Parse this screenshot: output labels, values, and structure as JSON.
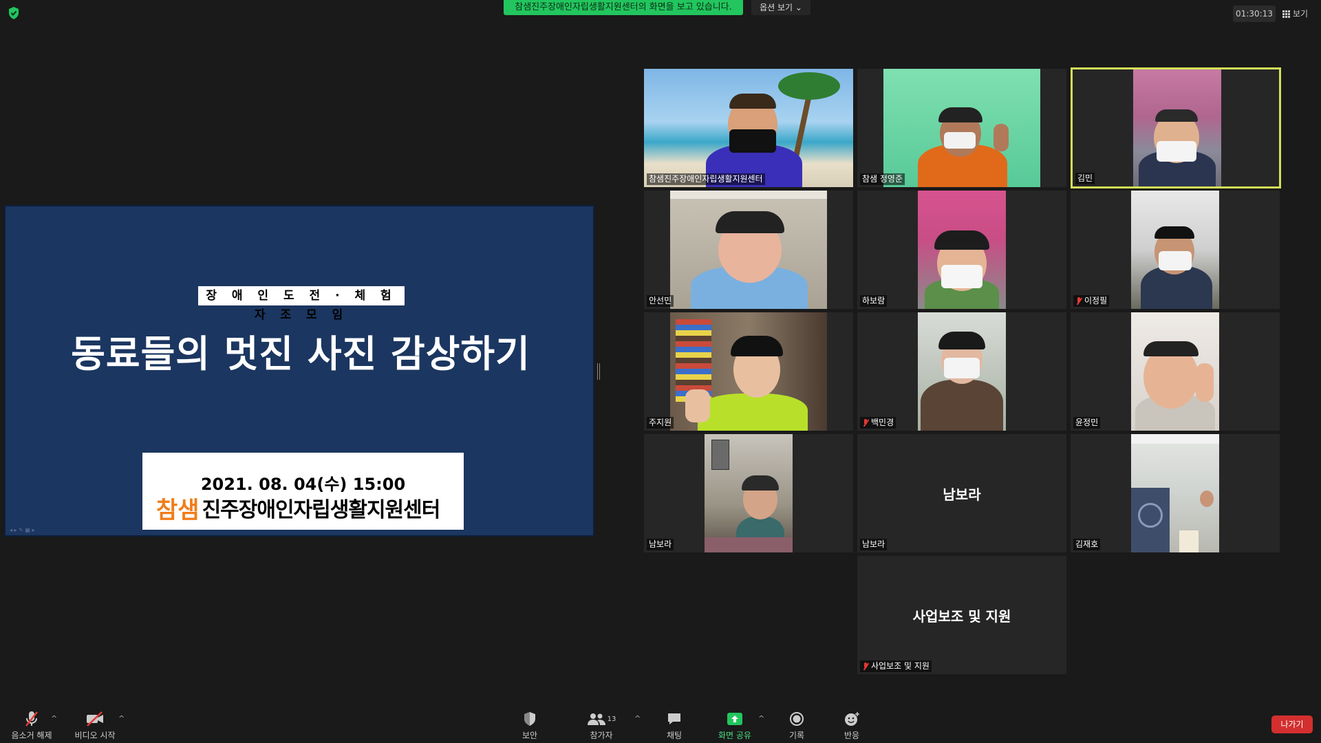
{
  "top": {
    "share_banner": "참샘진주장애인자립생활지원센터의 화면을 보고 있습니다.",
    "view_options": "옵션 보기",
    "timer": "01:30:13",
    "layout_label": "보기"
  },
  "slide": {
    "subtitle": "장 애 인 도 전 · 체 험 자 조 모 임",
    "title": "동료들의 멋진 사진 감상하기",
    "date": "2021. 08. 04(수) 15:00",
    "logo_text": "참샘",
    "org_name": "진주장애인자립생활지원센터"
  },
  "participants": [
    {
      "name": "참샘진주장애인자립생활지원센터",
      "muted": false
    },
    {
      "name": "참샘  정영준",
      "muted": false
    },
    {
      "name": "김민",
      "muted": false,
      "active_speaker": true
    },
    {
      "name": "안선민",
      "muted": false
    },
    {
      "name": "하보람",
      "muted": false
    },
    {
      "name": "이정필",
      "muted": true
    },
    {
      "name": "주지원",
      "muted": false
    },
    {
      "name": "백민경",
      "muted": true
    },
    {
      "name": "윤정민",
      "muted": false
    },
    {
      "name": "남보라",
      "muted": false
    },
    {
      "name": "남보라",
      "muted": false,
      "video_off": true,
      "display": "남보라"
    },
    {
      "name": "김재호",
      "muted": false
    },
    {
      "name": "사업보조 및 지원",
      "muted": true,
      "video_off": true,
      "display": "사업보조 및 지원"
    }
  ],
  "toolbar": {
    "unmute": "음소거 해제",
    "start_video": "비디오 시작",
    "security": "보안",
    "participants": "참가자",
    "participant_count": "13",
    "chat": "채팅",
    "share_screen": "화면 공유",
    "record": "기록",
    "reactions": "반응",
    "leave": "나가기"
  },
  "colors": {
    "share_green": "#22c55e",
    "slide_blue": "#1b3660",
    "active_border": "#d4e157",
    "leave_red": "#d32f2f"
  }
}
